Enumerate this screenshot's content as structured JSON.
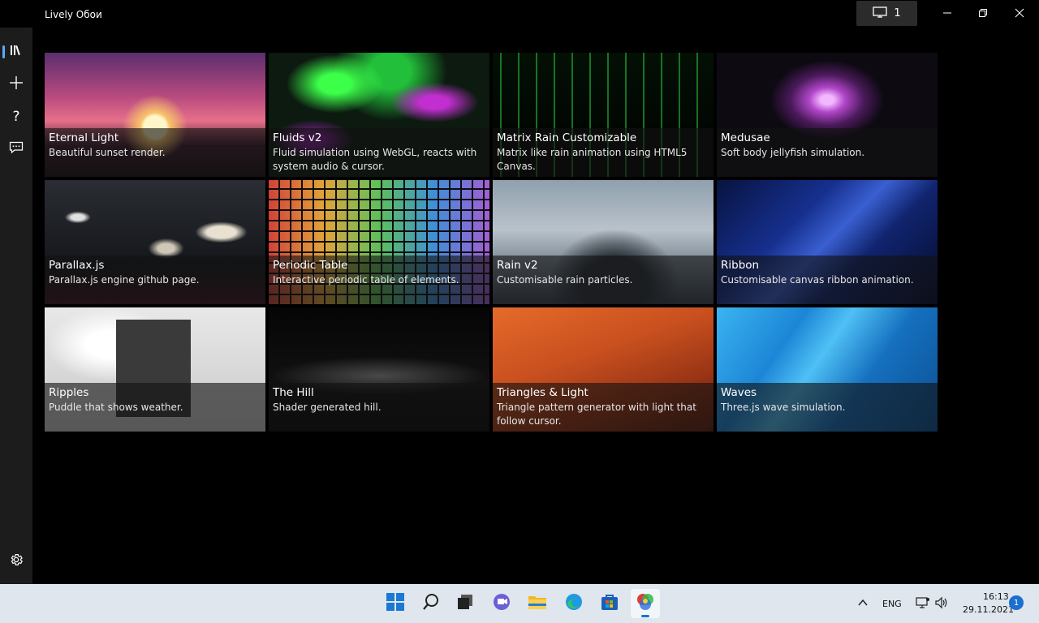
{
  "app": {
    "title": "Lively Обои",
    "monitor_count": "1",
    "accent": "#3a84d8"
  },
  "window_controls": [
    {
      "name": "minimize-icon"
    },
    {
      "name": "restore-icon"
    },
    {
      "name": "close-icon"
    }
  ],
  "sidebar": {
    "items": [
      {
        "icon": "library-icon",
        "active": true
      },
      {
        "icon": "plus-icon"
      },
      {
        "icon": "help-icon"
      },
      {
        "icon": "feedback-icon"
      }
    ],
    "bottom": {
      "icon": "gear-icon"
    }
  },
  "wallpapers": [
    {
      "title": "Eternal Light",
      "description": "Beautiful sunset render."
    },
    {
      "title": "Fluids v2",
      "description": "Fluid simulation using WebGL, reacts with system audio & cursor."
    },
    {
      "title": "Matrix Rain Customizable",
      "description": "Matrix like rain animation using HTML5 Canvas.",
      "selected": true
    },
    {
      "title": "Medusae",
      "description": "Soft body jellyfish simulation."
    },
    {
      "title": "Parallax.js",
      "description": "Parallax.js engine github page."
    },
    {
      "title": "Periodic Table",
      "description": "Interactive periodic table of elements."
    },
    {
      "title": "Rain v2",
      "description": "Customisable rain particles."
    },
    {
      "title": "Ribbon",
      "description": "Customisable canvas ribbon animation."
    },
    {
      "title": "Ripples",
      "description": "Puddle that shows weather."
    },
    {
      "title": "The Hill",
      "description": "Shader generated hill."
    },
    {
      "title": "Triangles & Light",
      "description": "Triangle pattern generator with light that follow cursor."
    },
    {
      "title": "Waves",
      "description": "Three.js wave simulation."
    }
  ],
  "taskbar": {
    "icons": [
      "windows-start-icon",
      "search-icon",
      "task-view-icon",
      "teams-chat-icon",
      "file-explorer-icon",
      "edge-browser-icon",
      "microsoft-store-icon",
      "lively-app-icon"
    ],
    "language": "ENG",
    "time": "16:13",
    "date": "29.11.2021",
    "notifications": "1"
  }
}
